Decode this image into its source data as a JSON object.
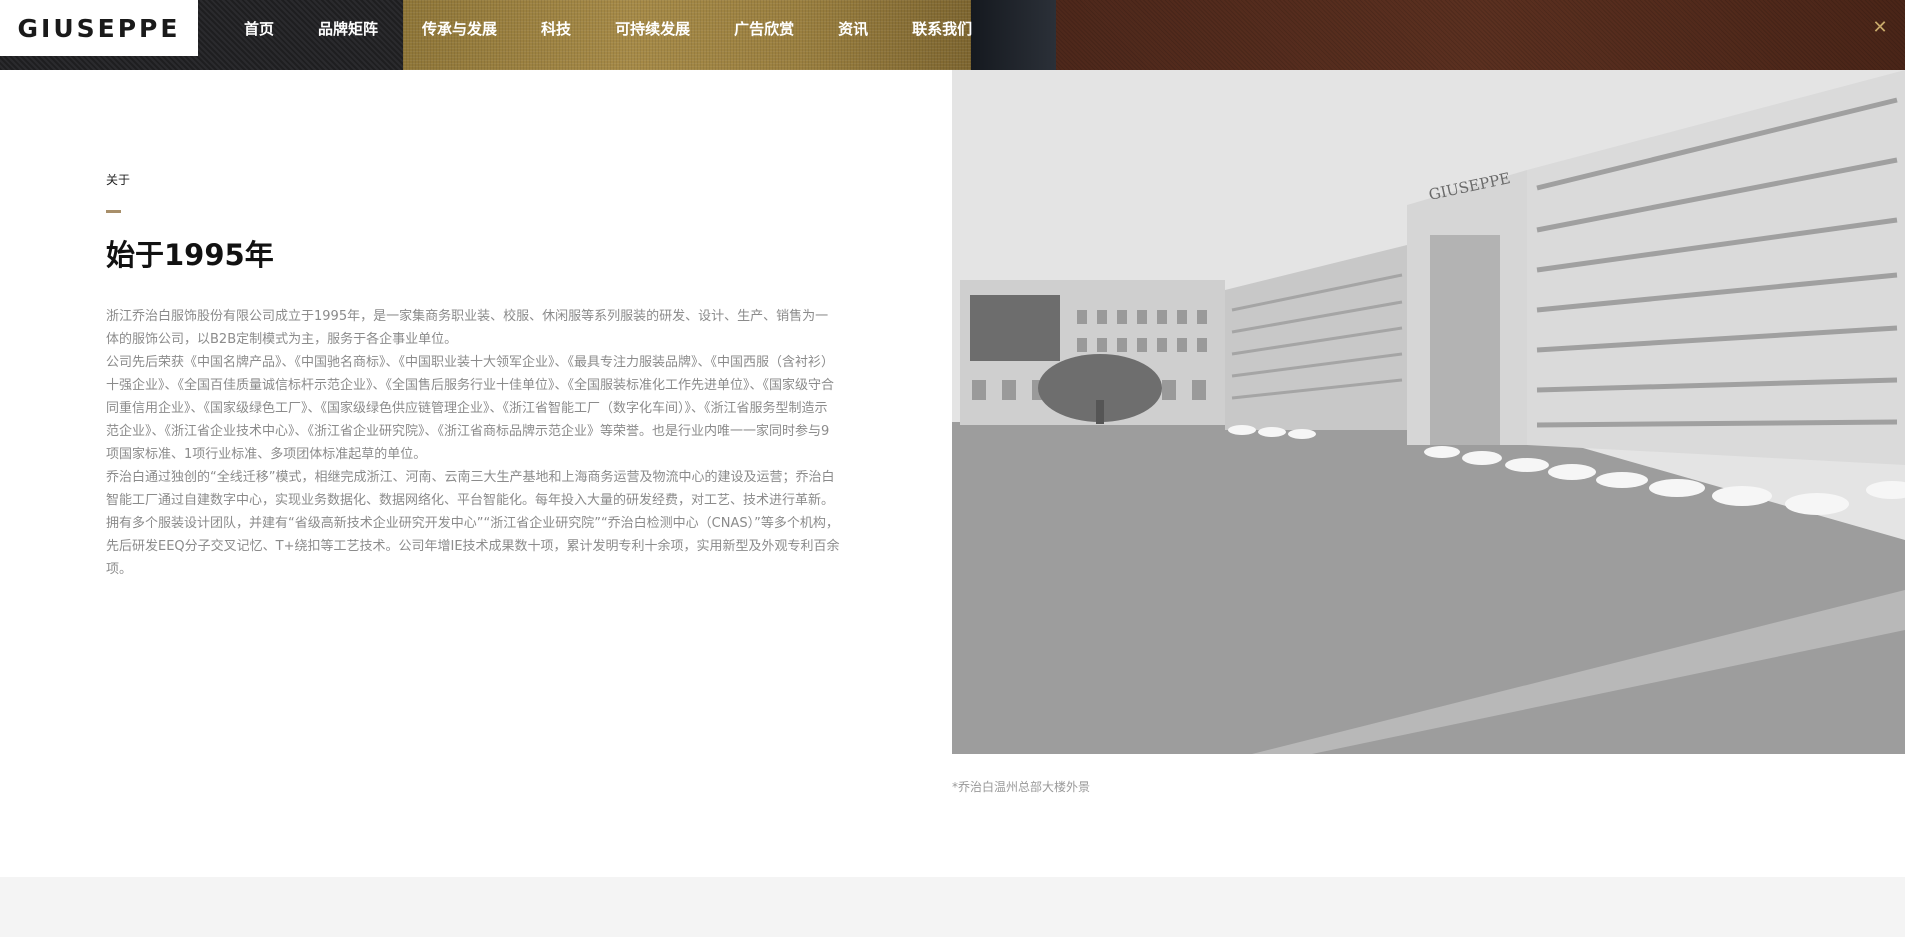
{
  "brand": {
    "logo_text": "GIUSEPPE"
  },
  "nav": {
    "items": [
      {
        "label": "首页"
      },
      {
        "label": "品牌矩阵"
      },
      {
        "label": "传承与发展"
      },
      {
        "label": "科技"
      },
      {
        "label": "可持续发展"
      },
      {
        "label": "广告欣赏"
      },
      {
        "label": "资讯"
      },
      {
        "label": "联系我们"
      }
    ],
    "close_icon": "close-icon",
    "accent_color": "#c8a96a"
  },
  "about": {
    "label": "关于",
    "heading": "始于1995年",
    "paragraphs": [
      "浙江乔治白服饰股份有限公司成立于1995年，是一家集商务职业装、校服、休闲服等系列服装的研发、设计、生产、销售为一体的服饰公司，以B2B定制模式为主，服务于各企事业单位。",
      "公司先后荣获《中国名牌产品》、《中国驰名商标》、《中国职业装十大领军企业》、《最具专注力服装品牌》、《中国西服（含衬衫）十强企业》、《全国百佳质量诚信标杆示范企业》、《全国售后服务行业十佳单位》、《全国服装标准化工作先进单位》、《国家级守合同重信用企业》、《国家级绿色工厂》、《国家级绿色供应链管理企业》、《浙江省智能工厂（数字化车间）》、《浙江省服务型制造示范企业》、《浙江省企业技术中心》、《浙江省企业研究院》、《浙江省商标品牌示范企业》等荣誉。也是行业内唯一一家同时参与9项国家标准、1项行业标准、多项团体标准起草的单位。",
      "乔治白通过独创的“全线迁移”模式，相继完成浙江、河南、云南三大生产基地和上海商务运营及物流中心的建设及运营；乔治白智能工厂通过自建数字中心，实现业务数据化、数据网络化、平台智能化。每年投入大量的研发经费，对工艺、技术进行革新。拥有多个服装设计团队，并建有“省级高新技术企业研究开发中心”“浙江省企业研究院”“乔治白检测中心（CNAS）”等多个机构，先后研发EEQ分子交叉记忆、T+绕扣等工艺技术。公司年增IE技术成果数十项，累计发明专利十余项，实用新型及外观专利百余项。"
    ],
    "accent_color": "#a88f6a"
  },
  "photo": {
    "building_sign": "GIUSEPPE",
    "caption": "*乔治白温州总部大楼外景"
  }
}
